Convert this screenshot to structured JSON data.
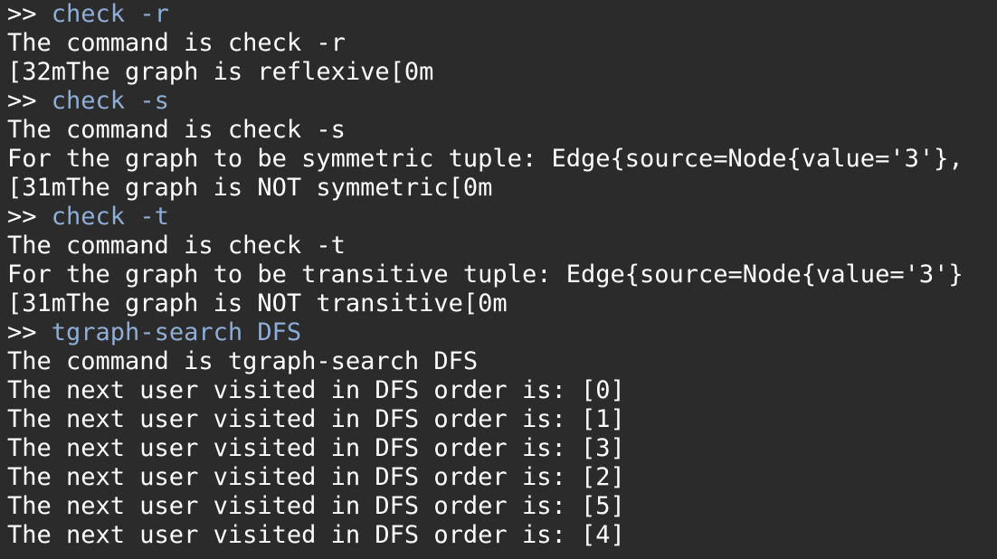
{
  "prompt": ">>",
  "lines": [
    {
      "kind": "input",
      "command": "check -r"
    },
    {
      "kind": "output",
      "text": "The command is check -r"
    },
    {
      "kind": "output",
      "text": "[32mThe graph is reflexive[0m"
    },
    {
      "kind": "input",
      "command": "check -s"
    },
    {
      "kind": "output",
      "text": "The command is check -s"
    },
    {
      "kind": "output",
      "text": "For the graph to be symmetric tuple: Edge{source=Node{value='3'},"
    },
    {
      "kind": "output",
      "text": "[31mThe graph is NOT symmetric[0m"
    },
    {
      "kind": "input",
      "command": "check -t"
    },
    {
      "kind": "output",
      "text": "The command is check -t"
    },
    {
      "kind": "output",
      "text": "For the graph to be transitive tuple: Edge{source=Node{value='3'}"
    },
    {
      "kind": "output",
      "text": "[31mThe graph is NOT transitive[0m"
    },
    {
      "kind": "input",
      "command": "tgraph-search DFS"
    },
    {
      "kind": "output",
      "text": "The command is tgraph-search DFS"
    },
    {
      "kind": "output",
      "text": "The next user visited in DFS order is: [0]"
    },
    {
      "kind": "output",
      "text": "The next user visited in DFS order is: [1]"
    },
    {
      "kind": "output",
      "text": "The next user visited in DFS order is: [3]"
    },
    {
      "kind": "output",
      "text": "The next user visited in DFS order is: [2]"
    },
    {
      "kind": "output",
      "text": "The next user visited in DFS order is: [5]"
    },
    {
      "kind": "output",
      "text": "The next user visited in DFS order is: [4]"
    }
  ]
}
